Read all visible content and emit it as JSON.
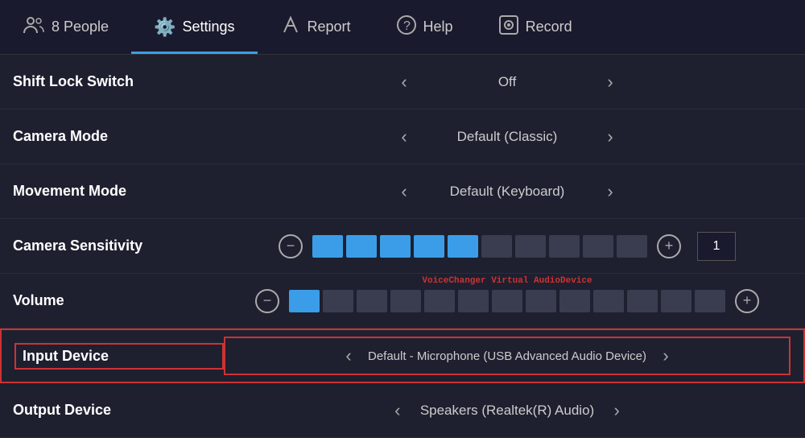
{
  "nav": {
    "items": [
      {
        "id": "people",
        "label": "8 People",
        "icon": "👤",
        "active": false
      },
      {
        "id": "settings",
        "label": "Settings",
        "icon": "⚙️",
        "active": true
      },
      {
        "id": "report",
        "label": "Report",
        "icon": "⚑",
        "active": false
      },
      {
        "id": "help",
        "label": "Help",
        "icon": "?",
        "active": false
      },
      {
        "id": "record",
        "label": "Record",
        "icon": "◎",
        "active": false
      }
    ]
  },
  "settings": {
    "rows": [
      {
        "id": "shift-lock-switch",
        "label": "Shift Lock Switch",
        "value": "Off",
        "type": "select",
        "highlighted": false
      },
      {
        "id": "camera-mode",
        "label": "Camera Mode",
        "value": "Default (Classic)",
        "type": "select",
        "highlighted": false
      },
      {
        "id": "movement-mode",
        "label": "Movement Mode",
        "value": "Default (Keyboard)",
        "type": "select",
        "highlighted": false
      },
      {
        "id": "camera-sensitivity",
        "label": "Camera Sensitivity",
        "value": "1",
        "type": "slider",
        "filledBlocks": 5,
        "totalBlocks": 10,
        "highlighted": false
      },
      {
        "id": "volume",
        "label": "Volume",
        "value": "",
        "type": "slider",
        "filledBlocks": 1,
        "totalBlocks": 13,
        "subLabel": "VoiceChanger Virtual AudioDevice",
        "highlighted": false
      },
      {
        "id": "input-device",
        "label": "Input Device",
        "value": "Default - Microphone (USB Advanced Audio Device)",
        "type": "select",
        "highlighted": true
      },
      {
        "id": "output-device",
        "label": "Output Device",
        "value": "Speakers (Realtek(R) Audio)",
        "type": "select",
        "highlighted": false
      }
    ]
  }
}
